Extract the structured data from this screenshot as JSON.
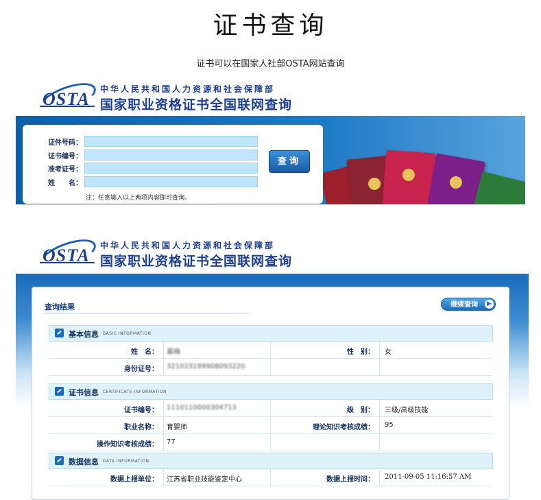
{
  "page": {
    "title": "证书查询",
    "subtitle": "证书可以在国家人社部OSTA网站查询"
  },
  "header": {
    "logo_text": "OSTA",
    "ministry": "中华人民共和国人力资源和社会保障部",
    "site_title": "国家职业资格证书全国联网查询"
  },
  "search_form": {
    "fields": [
      {
        "label": "证件号码：",
        "value": ""
      },
      {
        "label": "证书编号：",
        "value": ""
      },
      {
        "label": "准考证号：",
        "value": ""
      },
      {
        "label": "姓　　名：",
        "value": ""
      }
    ],
    "query_button": "查询",
    "note": "注：任意输入以上两项内容即可查询。"
  },
  "result": {
    "heading": "查询结果",
    "continue_button": "继续查询",
    "basic": {
      "title": "基本信息",
      "subtitle": "BASIC INFORMATION",
      "name_label": "姓　名：",
      "name_value": "葛梅",
      "gender_label": "性　别：",
      "gender_value": "女",
      "id_label": "身份证号：",
      "id_value": "321023199908093220"
    },
    "certificate": {
      "title": "证书信息",
      "subtitle": "CERTIFICATE INFORMATION",
      "cert_no_label": "证书编号：",
      "cert_no_value": "1110110000304713",
      "level_label": "级　别：",
      "level_value": "三级/高级技能",
      "occupation_label": "职业名称：",
      "occupation_value": "育婴师",
      "theory_label": "理论知识考核成绩：",
      "theory_value": "95",
      "practice_label": "操作知识考核成绩：",
      "practice_value": "77"
    },
    "data": {
      "title": "数据信息",
      "subtitle": "DATA INFORMATION",
      "unit_label": "数据上报单位：",
      "unit_value": "江苏省职业技能鉴定中心",
      "time_label": "数据上报时间：",
      "time_value": "2011-09-05 11:16:57 AM"
    }
  },
  "colors": {
    "brand_blue": "#1d3f8f",
    "banner_blue": "#0d5fa8",
    "input_fill": "#bfe5fa",
    "section_fill": "#def2fb"
  }
}
